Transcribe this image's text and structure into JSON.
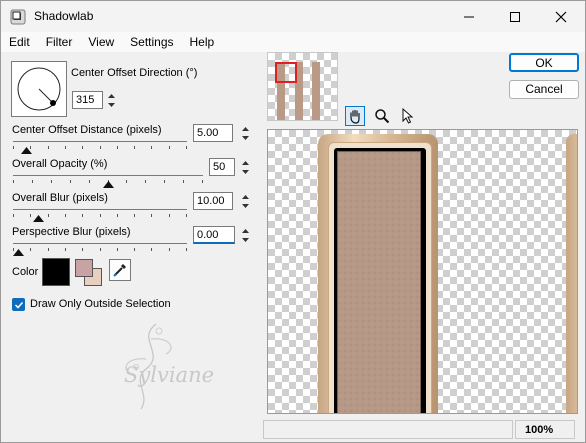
{
  "window": {
    "title": "Shadowlab"
  },
  "menu": [
    "Edit",
    "Filter",
    "View",
    "Settings",
    "Help"
  ],
  "direction": {
    "label": "Center Offset Direction (°)",
    "value": "315"
  },
  "distance": {
    "label": "Center Offset Distance (pixels)",
    "value": "5.00",
    "level": 0.05
  },
  "opacity": {
    "label": "Overall Opacity (%)",
    "value": "50",
    "level": 0.5
  },
  "blur": {
    "label": "Overall Blur (pixels)",
    "value": "10.00",
    "level": 0.12
  },
  "persp": {
    "label": "Perspective Blur (pixels)",
    "value": "0.00",
    "level": 0.0
  },
  "color": {
    "label": "Color",
    "shadow": "#000000",
    "fg": "#c9a3a3",
    "bg": "#e8cfc0"
  },
  "checkbox": {
    "label": "Draw Only Outside Selection",
    "checked": true
  },
  "buttons": {
    "ok": "OK",
    "cancel": "Cancel"
  },
  "status": {
    "zoom": "100%"
  },
  "watermark": "Sylviane",
  "colors": {
    "accent": "#0f6cbd",
    "frame_tan": "#b89a86",
    "frame_gold": "#e8cfa8"
  }
}
